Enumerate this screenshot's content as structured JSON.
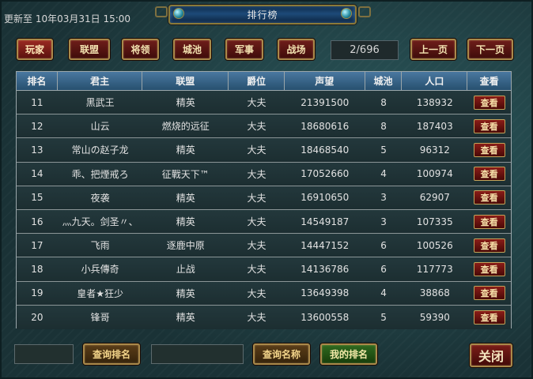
{
  "window": {
    "title": "排行榜"
  },
  "update_line": "更新至 10年03月31日 15:00",
  "tabs": [
    {
      "label": "玩家",
      "active": true
    },
    {
      "label": "联盟",
      "active": false
    },
    {
      "label": "将领",
      "active": false
    },
    {
      "label": "城池",
      "active": false
    },
    {
      "label": "军事",
      "active": false
    },
    {
      "label": "战场",
      "active": false
    }
  ],
  "pagination": {
    "current": "2/696",
    "prev_label": "上一页",
    "next_label": "下一页"
  },
  "table": {
    "headers": [
      "排名",
      "君主",
      "联盟",
      "爵位",
      "声望",
      "城池",
      "人口",
      "查看"
    ],
    "rows": [
      {
        "rank": "11",
        "lord": "黑武王",
        "alliance": "精英",
        "title": "大夫",
        "prestige": "21391500",
        "cities": "8",
        "population": "138932",
        "view": "查看"
      },
      {
        "rank": "12",
        "lord": "山云",
        "alliance": "燃烧的远征",
        "title": "大夫",
        "prestige": "18680616",
        "cities": "8",
        "population": "187403",
        "view": "查看"
      },
      {
        "rank": "13",
        "lord": "常山の赵子龙",
        "alliance": "精英",
        "title": "大夫",
        "prestige": "18468540",
        "cities": "5",
        "population": "96312",
        "view": "查看"
      },
      {
        "rank": "14",
        "lord": "乖、把煙戒ろ",
        "alliance": "征戰天下™",
        "title": "大夫",
        "prestige": "17052660",
        "cities": "4",
        "population": "100974",
        "view": "查看"
      },
      {
        "rank": "15",
        "lord": "夜袭",
        "alliance": "精英",
        "title": "大夫",
        "prestige": "16910650",
        "cities": "3",
        "population": "62907",
        "view": "查看"
      },
      {
        "rank": "16",
        "lord": "灬九天。剑圣〃、",
        "alliance": "精英",
        "title": "大夫",
        "prestige": "14549187",
        "cities": "3",
        "population": "107335",
        "view": "查看"
      },
      {
        "rank": "17",
        "lord": "飞雨",
        "alliance": "逐鹿中原",
        "title": "大夫",
        "prestige": "14447152",
        "cities": "6",
        "population": "100526",
        "view": "查看"
      },
      {
        "rank": "18",
        "lord": "小兵傳奇",
        "alliance": "止战",
        "title": "大夫",
        "prestige": "14136786",
        "cities": "6",
        "population": "117773",
        "view": "查看"
      },
      {
        "rank": "19",
        "lord": "皇者★狂少",
        "alliance": "精英",
        "title": "大夫",
        "prestige": "13649398",
        "cities": "4",
        "population": "38868",
        "view": "查看"
      },
      {
        "rank": "20",
        "lord": "锋哥",
        "alliance": "精英",
        "title": "大夫",
        "prestige": "13600558",
        "cities": "5",
        "population": "59390",
        "view": "查看"
      }
    ]
  },
  "bottom": {
    "rank_input_value": "",
    "rank_query_label": "查询排名",
    "name_input_value": "",
    "name_query_label": "查询名称",
    "my_rank_label": "我的排名",
    "close_label": "关闭"
  },
  "colors": {
    "accent_gold": "#a9894a",
    "button_red": "#6e1e1a",
    "header_blue": "#3a6a90",
    "button_green": "#2f6a1f"
  }
}
